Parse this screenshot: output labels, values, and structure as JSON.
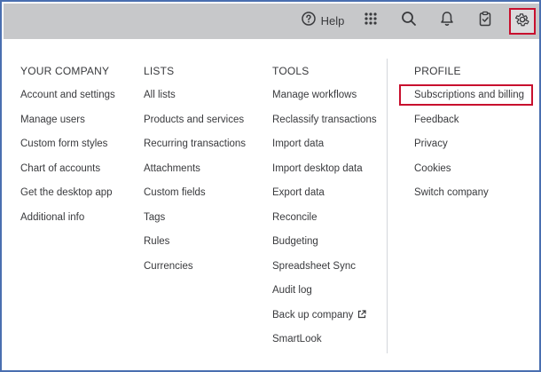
{
  "topbar": {
    "help_label": "Help",
    "icons": [
      "help-icon",
      "apps-grid-icon",
      "search-icon",
      "bell-icon",
      "clipboard-icon",
      "gear-icon"
    ],
    "highlight_color": "#c8102e",
    "bar_color": "#c7c8ca"
  },
  "columns": {
    "company": {
      "heading": "YOUR COMPANY",
      "items": [
        "Account and settings",
        "Manage users",
        "Custom form styles",
        "Chart of accounts",
        "Get the desktop app",
        "Additional info"
      ]
    },
    "lists": {
      "heading": "LISTS",
      "items": [
        "All lists",
        "Products and services",
        "Recurring transactions",
        "Attachments",
        "Custom fields",
        "Tags",
        "Rules",
        "Currencies"
      ]
    },
    "tools": {
      "heading": "TOOLS",
      "items": [
        "Manage workflows",
        "Reclassify transactions",
        "Import data",
        "Import desktop data",
        "Export data",
        "Reconcile",
        "Budgeting",
        "Spreadsheet Sync",
        "Audit log",
        "Back up company",
        "SmartLook"
      ]
    },
    "profile": {
      "heading": "PROFILE",
      "items": [
        "Subscriptions and billing",
        "Feedback",
        "Privacy",
        "Cookies",
        "Switch company"
      ]
    }
  }
}
